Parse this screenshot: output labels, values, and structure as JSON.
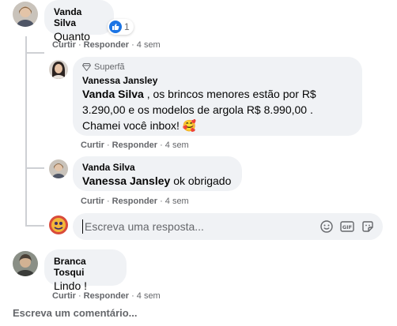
{
  "comments": [
    {
      "author": "Vanda Silva",
      "text": "Quanto",
      "reaction_count": "1",
      "actions": {
        "like": "Curtir",
        "reply": "Responder",
        "time": "4 sem"
      }
    }
  ],
  "replies": [
    {
      "badge": "Superfã",
      "author": "Vanessa Jansley",
      "mention": "Vanda Silva",
      "text_line1": " , os brincos menores estão por R$",
      "text_line2": "3.290,00 e os modelos de argola R$ 8.990,00 .",
      "text_line3": "Chamei você inbox! 🥰",
      "actions": {
        "like": "Curtir",
        "reply": "Responder",
        "time": "4 sem"
      }
    },
    {
      "author": "Vanda Silva",
      "mention": "Vanessa Jansley",
      "text": " ok obrigado",
      "actions": {
        "like": "Curtir",
        "reply": "Responder",
        "time": "4 sem"
      }
    }
  ],
  "reply_box": {
    "placeholder": "Escreva uma resposta...",
    "icons": [
      "emoji-icon",
      "gif-icon",
      "sticker-icon"
    ]
  },
  "second_comment": {
    "author": "Branca Tosqui",
    "text": "Lindo !",
    "actions": {
      "like": "Curtir",
      "reply": "Responder",
      "time": "4 sem"
    }
  },
  "write_comment": "Escreva um comentário...",
  "colors": {
    "bubble": "#f0f2f5",
    "secondary_text": "#65676b",
    "like_blue": "#1b74e4",
    "thread_line": "#ced0d4"
  }
}
